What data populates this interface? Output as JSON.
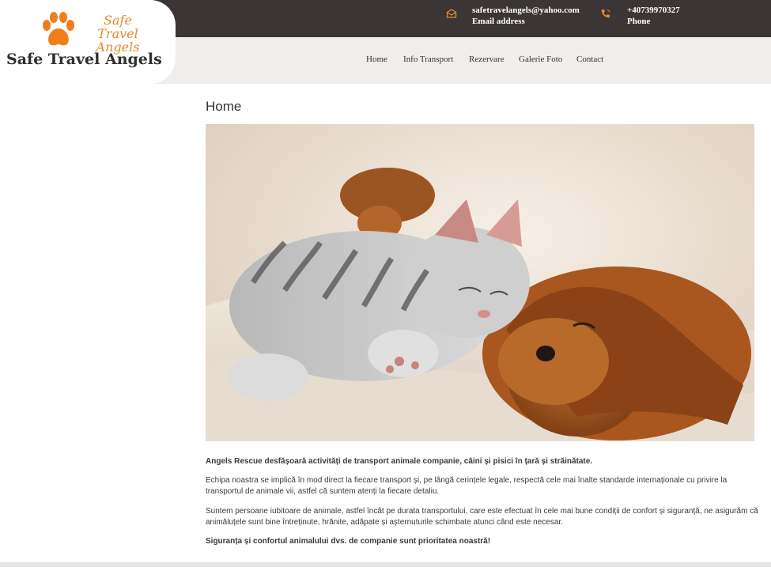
{
  "logo": {
    "script_line1": "Safe Travel",
    "script_line2": "Angels",
    "title": "Safe Travel Angels",
    "paw_color": "#ef7f1a"
  },
  "contacts": {
    "email": {
      "value": "safetravelangels@yahoo.com",
      "label": "Email address",
      "icon": "envelope-icon"
    },
    "phone": {
      "value": "+40739970327",
      "label": "Phone",
      "icon": "phone-icon"
    }
  },
  "nav": {
    "items": [
      {
        "label": "Home"
      },
      {
        "label": "Info Transport"
      },
      {
        "label": "Rezervare"
      },
      {
        "label": "Galerie Foto"
      },
      {
        "label": "Contact"
      }
    ]
  },
  "page": {
    "title": "Home",
    "paragraphs": [
      "Angels Rescue desfășoară activități de transport animale companie, câini și pisici în țară și străinătate.",
      "Echipa noastra se implică în mod direct la fiecare transport și, pe lângă cerințele legale, respectă cele mai înalte standarde internaționale cu privire la transportul de animale vii, astfel că suntem atenți la fiecare detaliu.",
      "Suntem persoane iubitoare de animale, astfel încât pe durata transportului, care este efectuat în cele mai bune condiții de confort și siguranță, ne asigurăm că animăluțele sunt bine întreținute, hrănite, adăpate și așternuturile schimbate atunci când este necesar.",
      "Siguranța și confortul animalului dvs. de companie sunt prioritatea noastră!"
    ]
  },
  "colors": {
    "topbar": "#3b3535",
    "navbar": "#efeeec",
    "accent": "#e58a2c"
  }
}
